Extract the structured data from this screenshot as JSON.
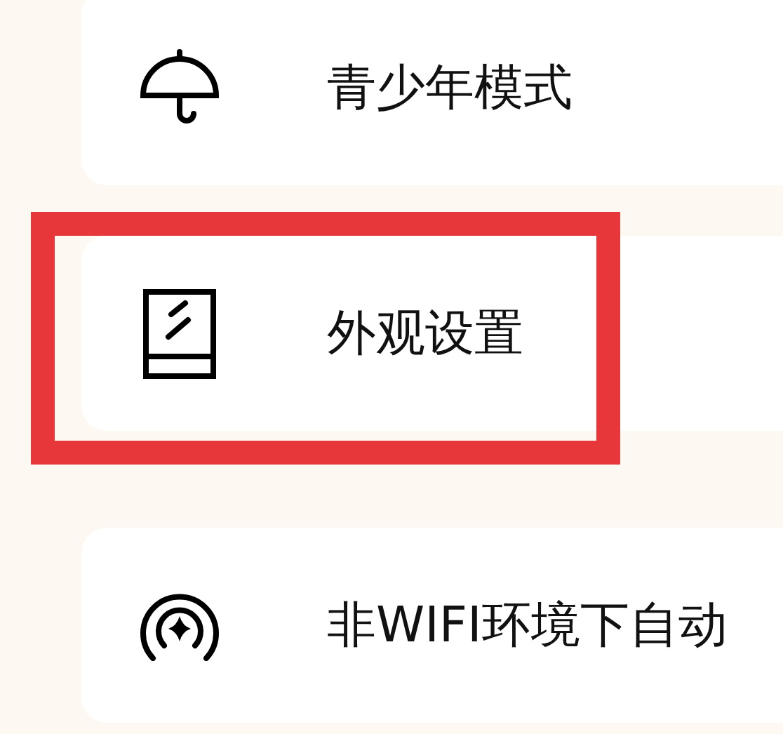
{
  "groups": [
    [
      {
        "label": "青少年模式",
        "highlighted": false
      },
      {
        "label": "外观设置",
        "highlighted": true
      }
    ],
    [
      {
        "label": "非WIFI环境下自动",
        "highlighted": false
      }
    ]
  ]
}
